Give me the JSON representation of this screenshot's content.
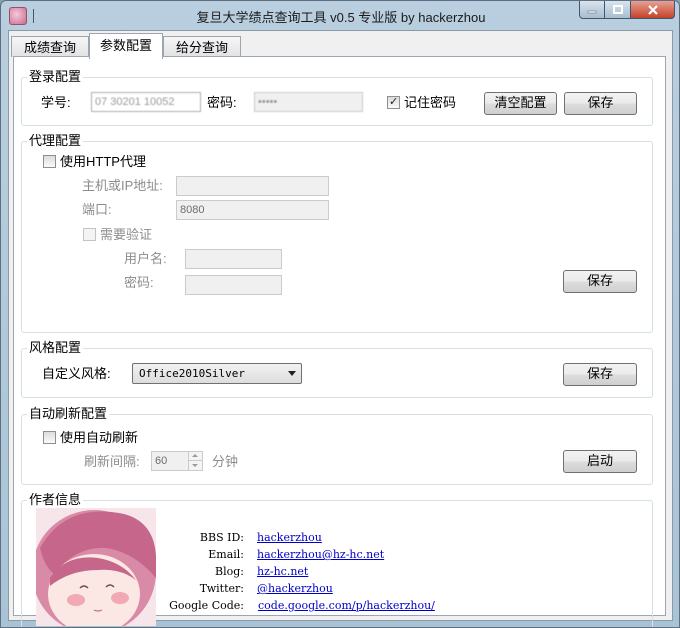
{
  "window": {
    "title": "复旦大学绩点查询工具 v0.5 专业版 by hackerzhou"
  },
  "tabs": [
    {
      "label": "成绩查询"
    },
    {
      "label": "参数配置"
    },
    {
      "label": "给分查询"
    }
  ],
  "login": {
    "group_label": "登录配置",
    "student_id_label": "学号:",
    "student_id_value": "07 30201 10052",
    "password_label": "密码:",
    "password_value": "•••••",
    "remember_label": "记住密码",
    "remember_checked": true,
    "clear_button": "清空配置",
    "save_button": "保存"
  },
  "proxy": {
    "group_label": "代理配置",
    "use_proxy_label": "使用HTTP代理",
    "host_label": "主机或IP地址:",
    "host_value": "",
    "port_label": "端口:",
    "port_value": "8080",
    "auth_label": "需要验证",
    "username_label": "用户名:",
    "password_label": "密码:",
    "save_button": "保存"
  },
  "style": {
    "group_label": "风格配置",
    "custom_label": "自定义风格:",
    "selected": "Office2010Silver",
    "save_button": "保存"
  },
  "refresh": {
    "group_label": "自动刷新配置",
    "use_label": "使用自动刷新",
    "interval_label": "刷新间隔:",
    "interval_value": "60",
    "unit_label": "分钟",
    "start_button": "启动"
  },
  "author": {
    "group_label": "作者信息",
    "rows": [
      {
        "key": "BBS ID:",
        "value": "hackerzhou"
      },
      {
        "key": "Email:",
        "value": "hackerzhou@hz-hc.net"
      },
      {
        "key": "Blog:",
        "value": "hz-hc.net"
      },
      {
        "key": "Twitter:",
        "value": "@hackerzhou"
      },
      {
        "key": "Google Code:",
        "value": "code.google.com/p/hackerzhou/"
      }
    ]
  },
  "colors": {
    "link": "#0000cc",
    "close_button": "#c4422b"
  }
}
